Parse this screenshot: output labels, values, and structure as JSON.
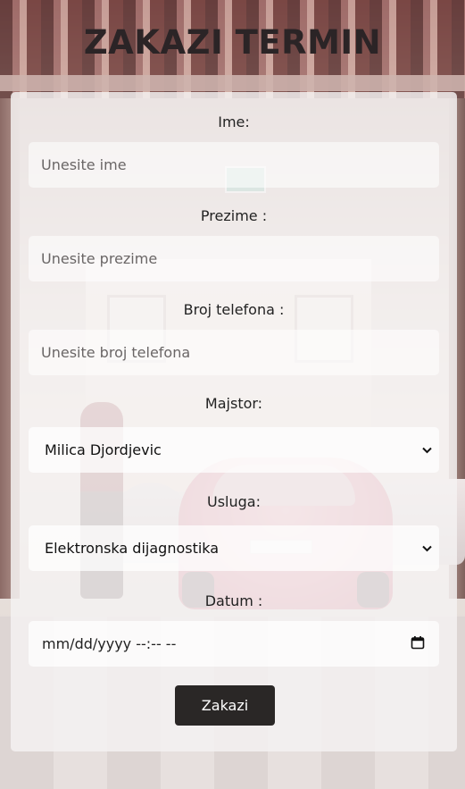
{
  "page": {
    "title": "ZAKAZI TERMIN"
  },
  "form": {
    "first_name": {
      "label": "Ime:",
      "placeholder": "Unesite ime",
      "value": ""
    },
    "last_name": {
      "label": "Prezime :",
      "placeholder": "Unesite prezime",
      "value": ""
    },
    "phone": {
      "label": "Broj telefona :",
      "placeholder": "Unesite broj telefona",
      "value": ""
    },
    "mechanic": {
      "label": "Majstor:",
      "selected": "Milica Djordjevic",
      "icon": "chevron-down-icon"
    },
    "service": {
      "label": "Usluga:",
      "selected": "Elektronska dijagnostika",
      "icon": "chevron-down-icon"
    },
    "date": {
      "label": "Datum :",
      "placeholder": "mm/dd/yyyy --:-- --",
      "icon": "calendar-icon"
    },
    "submit_label": "Zakazi"
  },
  "colors": {
    "title": "#2b2426",
    "button_bg": "#2a2726",
    "button_text": "#ffffff",
    "card_bg": "#f4f2f2"
  }
}
